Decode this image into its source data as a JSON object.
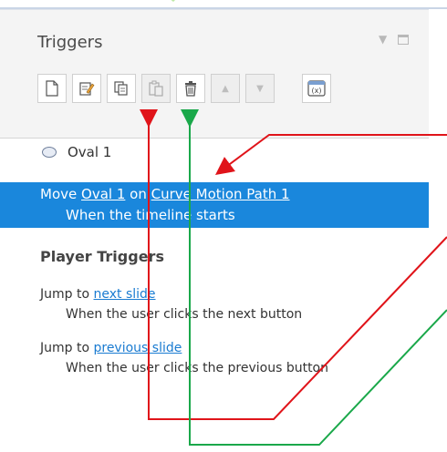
{
  "panel": {
    "title": "Triggers"
  },
  "header_icons": {
    "collapse": "dropdown-arrow-icon",
    "restore": "restore-window-icon"
  },
  "toolbar": {
    "buttons": [
      {
        "name": "new-trigger-button",
        "icon": "new-document-icon",
        "enabled": true
      },
      {
        "name": "edit-trigger-button",
        "icon": "edit-icon",
        "enabled": true
      },
      {
        "name": "copy-button",
        "icon": "copy-icon",
        "enabled": true
      },
      {
        "name": "paste-button",
        "icon": "paste-icon",
        "enabled": false
      },
      {
        "name": "delete-button",
        "icon": "trash-icon",
        "enabled": true
      },
      {
        "name": "move-up-button",
        "icon": "up-arrow-icon",
        "enabled": false
      },
      {
        "name": "move-down-button",
        "icon": "down-arrow-icon",
        "enabled": false
      },
      {
        "name": "variables-button",
        "icon": "variable-x-icon",
        "enabled": true
      }
    ]
  },
  "object": {
    "icon": "oval-icon",
    "label": "Oval 1"
  },
  "selected_trigger": {
    "action": "Move",
    "target": "Oval 1",
    "connector": "on",
    "path": "Curve Motion Path 1",
    "condition": "When the timeline starts"
  },
  "player_triggers": {
    "heading": "Player Triggers",
    "items": [
      {
        "action": "Jump to",
        "target": "next slide",
        "condition": "When the user clicks the next button"
      },
      {
        "action": "Jump to",
        "target": "previous slide",
        "condition": "When the user clicks the previous button"
      }
    ]
  },
  "colors": {
    "selection": "#1a87dc",
    "link": "#1a7bd1",
    "annotation_red": "#e0141a",
    "annotation_green": "#1aa84a",
    "deco_green": "#bfe9a8"
  }
}
